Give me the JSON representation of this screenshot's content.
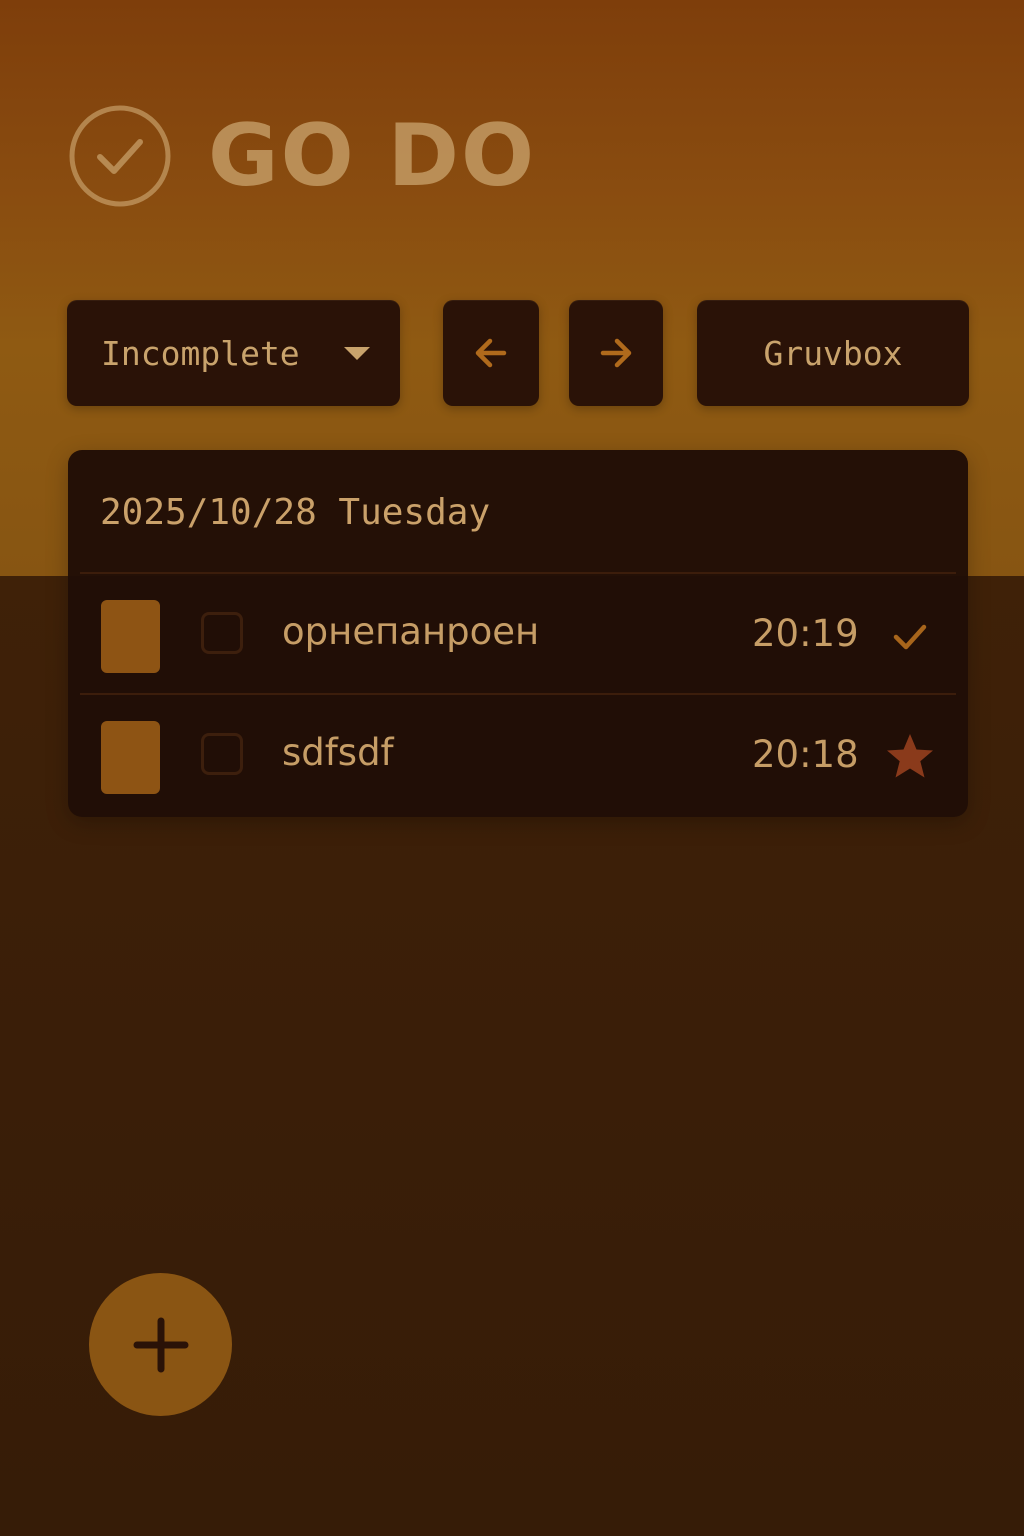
{
  "app": {
    "title": "GO DO"
  },
  "toolbar": {
    "filter": {
      "selected": "Incomplete"
    },
    "theme_label": "Gruvbox"
  },
  "day": {
    "date_label": "2025/10/28 Tuesday",
    "tasks": [
      {
        "title": "орнепанроен",
        "time": "20:19",
        "completed": false,
        "action_icon": "check-icon"
      },
      {
        "title": "sdfsdf",
        "time": "20:18",
        "completed": false,
        "action_icon": "star-icon"
      }
    ]
  },
  "icons": {
    "logo": "check-circle-icon",
    "filter_caret": "chevron-down-icon",
    "prev": "arrow-left-icon",
    "next": "arrow-right-icon",
    "fab": "plus-icon"
  },
  "colors": {
    "accent": "#c9a36c",
    "button_bg": "#2a1207",
    "card_bg": "#200e06",
    "swatch": "#8e5414",
    "arrow": "#b06a1c",
    "star": "#8a3a1b",
    "fab_bg": "#8a5513"
  }
}
